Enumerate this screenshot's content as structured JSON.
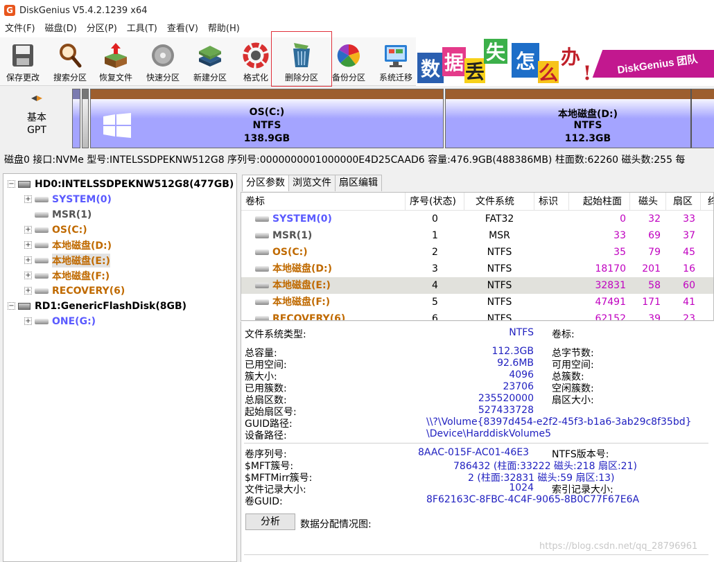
{
  "window": {
    "title": "DiskGenius V5.4.2.1239 x64",
    "app_icon_glyph": "G"
  },
  "menu": [
    "文件(F)",
    "磁盘(D)",
    "分区(P)",
    "工具(T)",
    "查看(V)",
    "帮助(H)"
  ],
  "toolbar": {
    "save": "保存更改",
    "search": "搜索分区",
    "recover": "恢复文件",
    "quick": "快速分区",
    "new": "新建分区",
    "format": "格式化",
    "delete": "删除分区",
    "backup": "备份分区",
    "migrate": "系统迁移"
  },
  "banner": {
    "chars": [
      "数",
      "据",
      "丢",
      "失",
      "怎",
      "么",
      "办",
      "!"
    ],
    "tagline": "DiskGenius 团队"
  },
  "diskbar": {
    "label_line1": "基本",
    "label_line2": "GPT",
    "partitions": [
      {
        "name": "OS(C:)",
        "fs": "NTFS",
        "size": "138.9GB"
      },
      {
        "name": "本地磁盘(D:)",
        "fs": "NTFS",
        "size": "112.3GB"
      }
    ]
  },
  "disk_info": "磁盘0 接口:NVMe  型号:INTELSSDPEKNW512G8  序列号:0000000001000000E4D25CAAD6  容量:476.9GB(488386MB)  柱面数:62260  磁头数:255  每",
  "tree": {
    "disks": [
      {
        "label": "HD0:INTELSSDPEKNW512G8(477GB)",
        "partitions": [
          {
            "label": "SYSTEM(0)",
            "color": "#5a5aff"
          },
          {
            "label": "MSR(1)",
            "color": "#555555"
          },
          {
            "label": "OS(C:)",
            "color": "#c06a00"
          },
          {
            "label": "本地磁盘(D:)",
            "color": "#c06a00"
          },
          {
            "label": "本地磁盘(E:)",
            "color": "#c06a00"
          },
          {
            "label": "本地磁盘(F:)",
            "color": "#c06a00"
          },
          {
            "label": "RECOVERY(6)",
            "color": "#c06a00"
          }
        ]
      },
      {
        "label": "RD1:GenericFlashDisk(8GB)",
        "partitions": [
          {
            "label": "ONE(G:)",
            "color": "#5a5aff"
          }
        ]
      }
    ]
  },
  "tabs": [
    "分区参数",
    "浏览文件",
    "扇区编辑"
  ],
  "table": {
    "headers": [
      "卷标",
      "序号(状态)",
      "文件系统",
      "标识",
      "起始柱面",
      "磁头",
      "扇区",
      "终"
    ],
    "rows": [
      {
        "label": "SYSTEM(0)",
        "color": "#5a5aff",
        "index": "0",
        "fs": "FAT32",
        "cyl": "0",
        "head": "32",
        "sector": "33"
      },
      {
        "label": "MSR(1)",
        "color": "#555555",
        "index": "1",
        "fs": "MSR",
        "cyl": "33",
        "head": "69",
        "sector": "37"
      },
      {
        "label": "OS(C:)",
        "color": "#c06a00",
        "index": "2",
        "fs": "NTFS",
        "cyl": "35",
        "head": "79",
        "sector": "45"
      },
      {
        "label": "本地磁盘(D:)",
        "color": "#c06a00",
        "index": "3",
        "fs": "NTFS",
        "cyl": "18170",
        "head": "201",
        "sector": "16"
      },
      {
        "label": "本地磁盘(E:)",
        "color": "#c06a00",
        "index": "4",
        "fs": "NTFS",
        "cyl": "32831",
        "head": "58",
        "sector": "60"
      },
      {
        "label": "本地磁盘(F:)",
        "color": "#c06a00",
        "index": "5",
        "fs": "NTFS",
        "cyl": "47491",
        "head": "171",
        "sector": "41"
      },
      {
        "label": "RECOVERY(6)",
        "color": "#c06a00",
        "index": "6",
        "fs": "NTFS",
        "cyl": "62152",
        "head": "39",
        "sector": "23"
      }
    ]
  },
  "info": {
    "fs_type_label": "文件系统类型:",
    "fs_type": "NTFS",
    "vol_label": "卷标:",
    "total_cap_label": "总容量:",
    "total_cap": "112.3GB",
    "total_bytes_label": "总字节数:",
    "used_label": "已用空间:",
    "used": "92.6MB",
    "free_label": "可用空间:",
    "cluster_label": "簇大小:",
    "cluster": "4096",
    "total_clusters_label": "总簇数:",
    "used_clusters_label": "已用簇数:",
    "used_clusters": "23706",
    "free_clusters_label": "空闲簇数:",
    "total_sectors_label": "总扇区数:",
    "total_sectors": "235520000",
    "sector_size_label": "扇区大小:",
    "start_sector_label": "起始扇区号:",
    "start_sector": "527433728",
    "guid_path_label": "GUID路径:",
    "guid_path": "\\\\?\\Volume{8397d454-e2f2-45f3-b1a6-3ab29c8f35bd}",
    "device_path_label": "设备路径:",
    "device_path": "\\Device\\HarddiskVolume5",
    "serial_label": "卷序列号:",
    "serial": "8AAC-015F-AC01-46E3",
    "ntfs_ver_label": "NTFS版本号:",
    "mft_label": "$MFT簇号:",
    "mft": "786432 (柱面:33222 磁头:218 扇区:21)",
    "mftmirr_label": "$MFTMirr簇号:",
    "mftmirr": "2 (柱面:32831 磁头:59 扇区:13)",
    "record_size_label": "文件记录大小:",
    "record_size": "1024",
    "index_size_label": "索引记录大小:",
    "volguid_label": "卷GUID:",
    "volguid": "8F62163C-8FBC-4C4F-9065-8B0C77F67E6A",
    "analyze": "分析",
    "alloc_map_label": "数据分配情况图:"
  },
  "watermark": "https://blog.csdn.net/qq_28796961"
}
